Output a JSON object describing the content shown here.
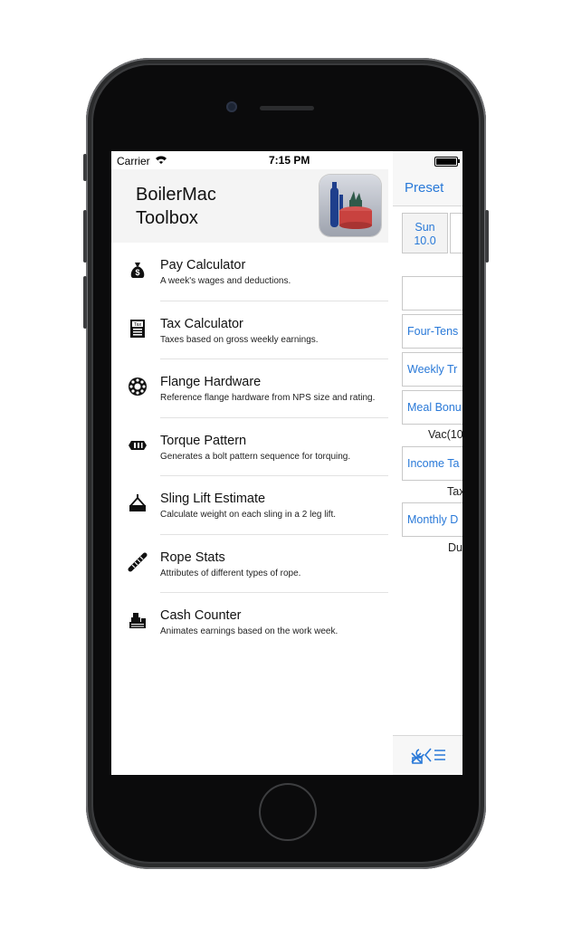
{
  "status": {
    "carrier": "Carrier",
    "time": "7:15 PM"
  },
  "header": {
    "title": "BoilerMac\nToolbox"
  },
  "menu": {
    "items": [
      {
        "title": "Pay Calculator",
        "subtitle": "A week's wages and deductions.",
        "icon": "money-bag-icon"
      },
      {
        "title": "Tax Calculator",
        "subtitle": "Taxes based on gross weekly earnings.",
        "icon": "tax-document-icon"
      },
      {
        "title": "Flange Hardware",
        "subtitle": "Reference flange hardware from NPS size and rating.",
        "icon": "flange-icon"
      },
      {
        "title": "Torque Pattern",
        "subtitle": "Generates a bolt pattern sequence for torquing.",
        "icon": "bolt-nut-icon"
      },
      {
        "title": "Sling Lift Estimate",
        "subtitle": "Calculate weight on each sling in a 2 leg lift.",
        "icon": "sling-lift-icon"
      },
      {
        "title": "Rope Stats",
        "subtitle": "Attributes of different types of rope.",
        "icon": "rope-icon"
      },
      {
        "title": "Cash Counter",
        "subtitle": "Animates earnings based on the work week.",
        "icon": "cash-stack-icon"
      }
    ]
  },
  "detail": {
    "nav_button": "Preset",
    "day_name": "Sun",
    "day_value": "10.0",
    "fields": [
      "Four-Tens",
      "Weekly Tr",
      "Meal Bonu",
      "Income Ta",
      "Monthly D"
    ],
    "captions": [
      "Vac(10",
      "Tax",
      "Du"
    ]
  },
  "colors": {
    "accent": "#2979d8",
    "header_bg": "#f4f4f4",
    "logo_red": "#c8423f",
    "logo_blue": "#1f3f8c",
    "logo_green": "#2f5a4a"
  }
}
